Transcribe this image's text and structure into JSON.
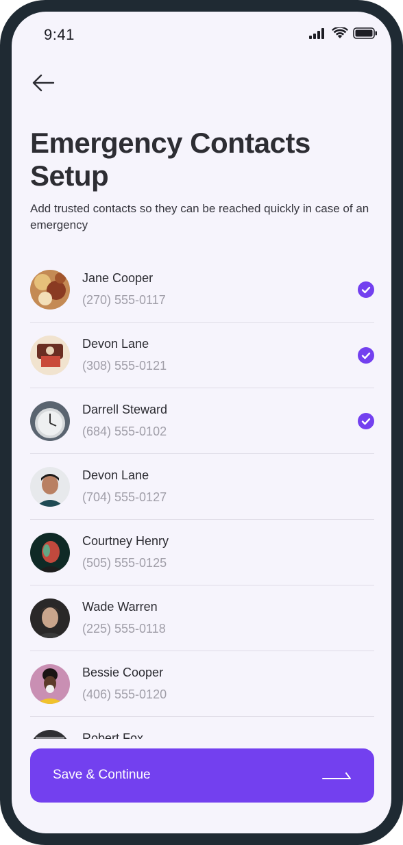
{
  "status_bar": {
    "time": "9:41"
  },
  "header": {
    "title_line1": "Emergency Contacts",
    "title_line2": "Setup",
    "subtitle": "Add trusted contacts so they can be reached quickly in case of an emergency"
  },
  "contacts": [
    {
      "name": "Jane Cooper",
      "phone": "(270) 555-0117",
      "selected": true
    },
    {
      "name": "Devon Lane",
      "phone": "(308) 555-0121",
      "selected": true
    },
    {
      "name": "Darrell Steward",
      "phone": "(684) 555-0102",
      "selected": true
    },
    {
      "name": "Devon Lane",
      "phone": "(704) 555-0127",
      "selected": false
    },
    {
      "name": "Courtney Henry",
      "phone": "(505) 555-0125",
      "selected": false
    },
    {
      "name": "Wade Warren",
      "phone": "(225) 555-0118",
      "selected": false
    },
    {
      "name": "Bessie Cooper",
      "phone": "(406) 555-0120",
      "selected": false
    },
    {
      "name": "Robert Fox",
      "phone": "",
      "selected": false
    }
  ],
  "footer": {
    "save_label": "Save & Continue"
  },
  "colors": {
    "accent": "#7340ef",
    "background": "#f6f4fc",
    "frame": "#1f2a33"
  },
  "icons": {
    "back": "arrow-left-icon",
    "check": "check-circle-icon",
    "continue": "arrow-right-icon",
    "signal": "signal-icon",
    "wifi": "wifi-icon",
    "battery": "battery-icon"
  }
}
